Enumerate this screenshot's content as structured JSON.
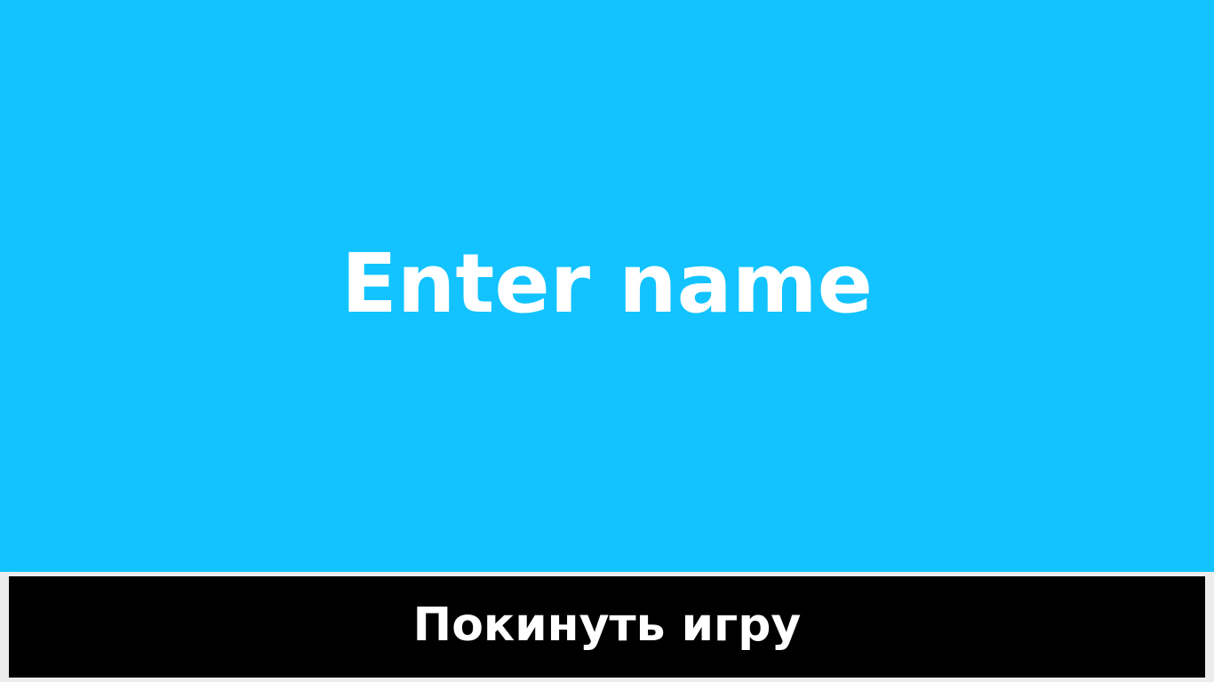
{
  "name_screen": {
    "prompt": "Enter name",
    "background_color": "#12c3ff",
    "text_color": "#ffffff"
  },
  "quit_button": {
    "label": "Покинуть игру",
    "background_color": "#000000",
    "text_color": "#ffffff"
  },
  "page": {
    "background_color": "#ececec"
  }
}
